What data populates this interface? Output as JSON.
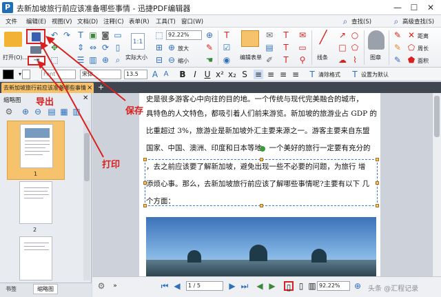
{
  "window": {
    "title": "去新加坡旅行前应该准备哪些事情 - 迅捷PDF编辑器",
    "app_icon": "P",
    "minimize": "—",
    "maximize": "☐",
    "close": "✕"
  },
  "menu": [
    "文件",
    "编辑(E)",
    "视图(V)",
    "文档(D)",
    "注释(C)",
    "表单(R)",
    "工具(T)",
    "窗口(W)"
  ],
  "menu_right": {
    "search": "查找(S)",
    "advanced_search": "高级查找(S)"
  },
  "ribbon": {
    "open": "打开(O)...",
    "zoom_value": "92.22%",
    "actual_size": "实际大小",
    "actual_size_icon_text": "1:1",
    "zoom_in": "放大",
    "zoom_out": "缩小",
    "edit_form": "编辑表单",
    "line": "线条",
    "stamp": "图章",
    "distance": "距离",
    "perimeter": "周长",
    "area": "面积"
  },
  "format": {
    "font_preview": "Font",
    "font_name": "宋体",
    "font_size": "13.5",
    "clear_format": "清除格式",
    "set_default": "设置为默认"
  },
  "tab": {
    "label": "去新加坡旅行前应该准备哪些事情",
    "close": "×"
  },
  "sidebar": {
    "title": "缩略图",
    "pages": [
      "1",
      "2"
    ],
    "tabs": [
      "书签",
      "缩略图"
    ]
  },
  "document": {
    "lines": [
      "史是很多游客心中向往的目的地。一个传统与现代完美融合的城市，",
      "具特色的人文特色，都吸引着人们前来游览。新加坡的旅游业占 GDP 的",
      "比重超过 3%，旅游业是新加坡外汇主要来源之一。游客主要来自东盟",
      "国家、中国、澳洲、印度和日本等地。一个美好的旅行一定要有充分的",
      "，去之前应该要了解新加坡，避免出现一些不必要的问题，为旅行 增",
      "添烦心事。那么，去新加坡旅行前应该了解哪些事情呢?主要有以下 几",
      "个方面："
    ]
  },
  "statusbar": {
    "page_input": "1",
    "page_total": "/ 5",
    "zoom": "92.22%"
  },
  "annotations": {
    "export": "导出",
    "print": "打印",
    "save": "保存"
  },
  "watermark": "头条 @汇程记录",
  "colors": {
    "accent": "#d9201f",
    "tab": "#f6c26b",
    "selection": "#3b7dd8"
  }
}
